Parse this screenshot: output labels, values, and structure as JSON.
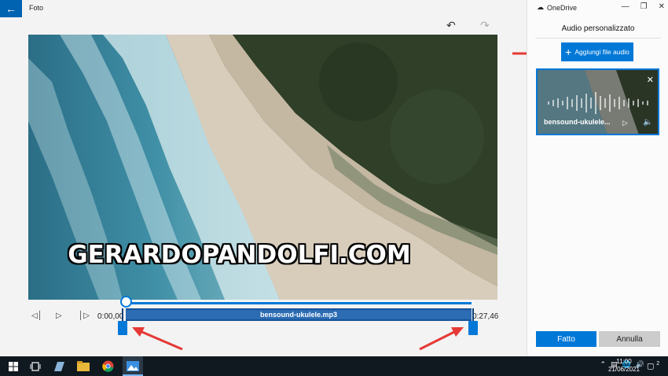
{
  "app": {
    "title": "Foto"
  },
  "toolbar": {
    "undo_icon": "undo-icon",
    "redo_icon": "redo-icon"
  },
  "video": {
    "watermark": "GERARDOPANDOLFI.COM"
  },
  "timeline": {
    "start_time": "0:00,00",
    "end_time": "0:27,46",
    "audio_track_label": "bensound-ukulele.mp3"
  },
  "panel": {
    "onedrive_label": "OneDrive",
    "title": "Audio personalizzato",
    "add_audio_label": "Aggiungi file audio",
    "audio_card": {
      "name": "bensound-ukulele..."
    },
    "done_label": "Fatto",
    "cancel_label": "Annulla"
  },
  "taskbar": {
    "time": "11:00",
    "date": "21/06/2021",
    "notification_count": "2"
  },
  "colors": {
    "accent": "#0078d7",
    "annotation_arrow": "#e53935",
    "taskbar": "#101820"
  }
}
